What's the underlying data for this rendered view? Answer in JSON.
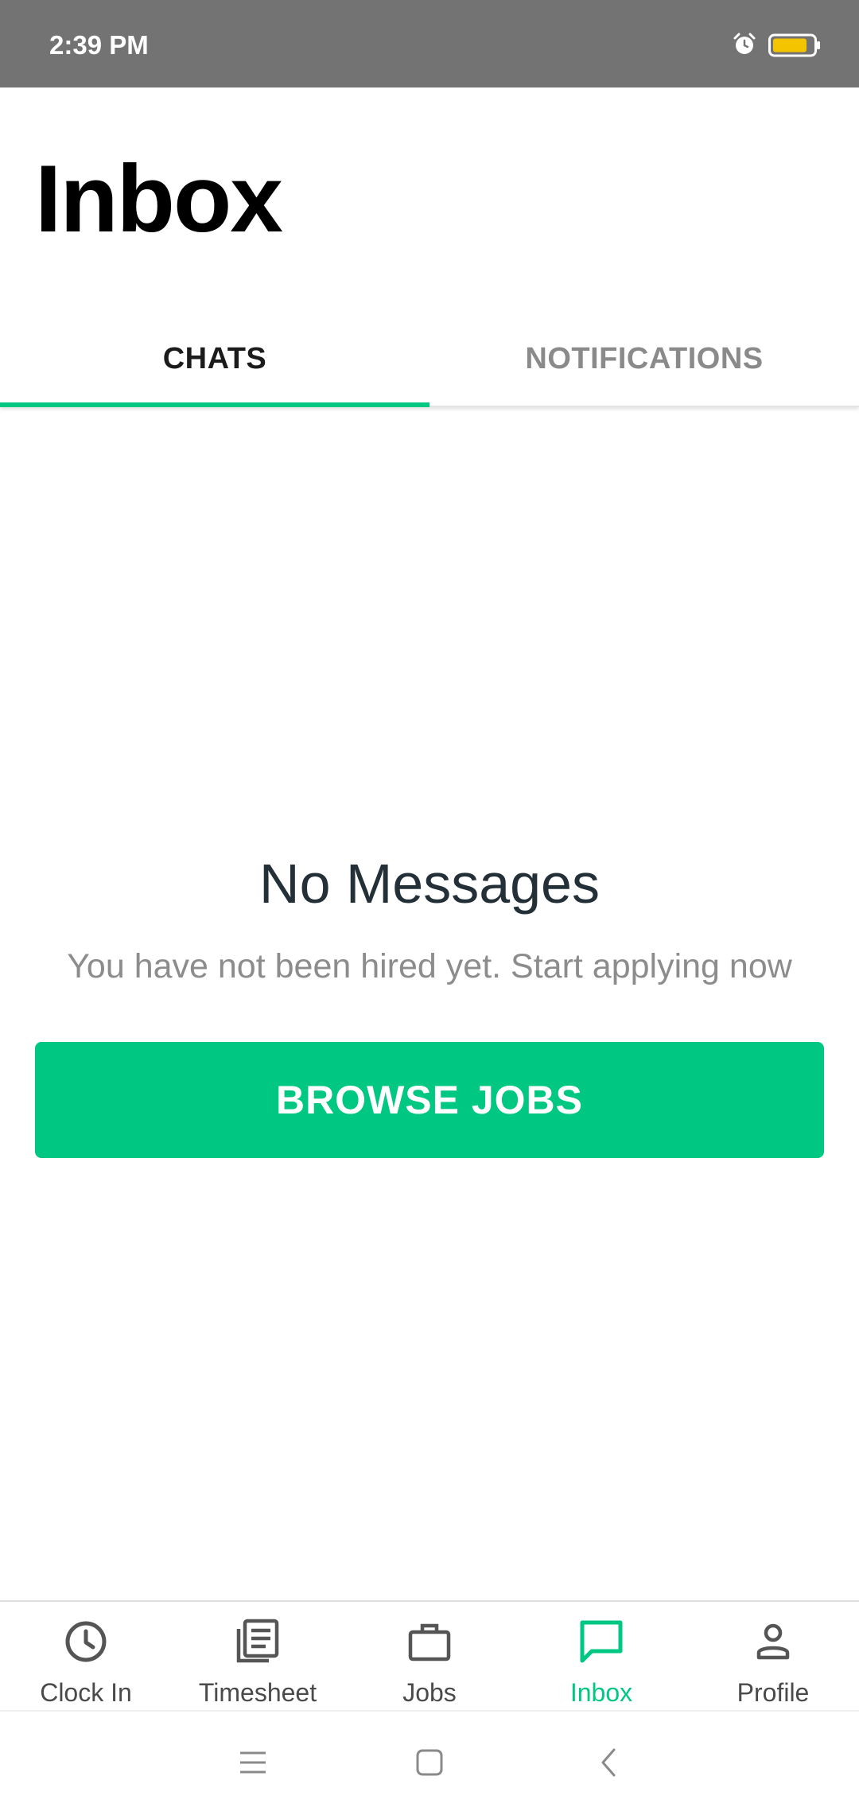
{
  "status_bar": {
    "time": "2:39 PM",
    "icons": [
      "alarm-icon",
      "battery-icon"
    ],
    "battery_color": "#f5c400"
  },
  "header": {
    "title": "Inbox"
  },
  "tabs": [
    {
      "label": "CHATS",
      "selected": true
    },
    {
      "label": "NOTIFICATIONS",
      "selected": false
    }
  ],
  "empty_state": {
    "title": "No Messages",
    "subtitle": "You have not been hired yet. Start applying now",
    "button_label": "BROWSE JOBS"
  },
  "bottom_nav": {
    "items": [
      {
        "label": "Clock In",
        "icon": "clock-icon",
        "active": false
      },
      {
        "label": "Timesheet",
        "icon": "timesheet-icon",
        "active": false
      },
      {
        "label": "Jobs",
        "icon": "briefcase-icon",
        "active": false
      },
      {
        "label": "Inbox",
        "icon": "chat-icon",
        "active": true
      },
      {
        "label": "Profile",
        "icon": "person-icon",
        "active": false
      }
    ]
  },
  "system_nav": {
    "icons": [
      "menu-icon",
      "home-square-icon",
      "back-icon"
    ]
  },
  "colors": {
    "accent": "#00c781",
    "status_bar": "#737373",
    "title_text": "#243038",
    "muted_text": "#8c8c8c"
  }
}
